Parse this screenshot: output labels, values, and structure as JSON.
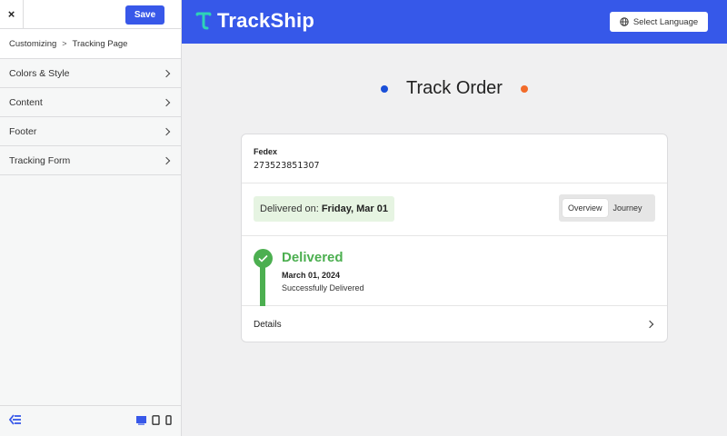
{
  "sidebar": {
    "close_icon": "×",
    "save_label": "Save",
    "breadcrumb": {
      "parent": "Customizing",
      "current": "Tracking Page"
    },
    "items": [
      {
        "label": "Colors & Style"
      },
      {
        "label": "Content"
      },
      {
        "label": "Footer"
      },
      {
        "label": "Tracking Form"
      }
    ],
    "footer_icons": [
      "collapse-sidebar-icon",
      "desktop-icon",
      "tablet-icon",
      "mobile-icon"
    ]
  },
  "header": {
    "brand": "TrackShip",
    "language_label": "Select Language",
    "colors": {
      "bar": "#3658e9",
      "accent": "#3858e9"
    }
  },
  "page": {
    "title": "Track Order",
    "dot_left_color": "#1a4fd8",
    "dot_right_color": "#f26b2a"
  },
  "tracking": {
    "carrier": "Fedex",
    "tracking_number": "273523851307",
    "delivered_on_label": "Delivered on:",
    "delivered_on_value": "Friday, Mar 01",
    "tabs": [
      "Overview",
      "Journey"
    ],
    "active_tab": "Overview",
    "event": {
      "status": "Delivered",
      "date": "March 01, 2024",
      "description": "Successfully Delivered",
      "color": "#4caf50"
    },
    "details_label": "Details"
  }
}
